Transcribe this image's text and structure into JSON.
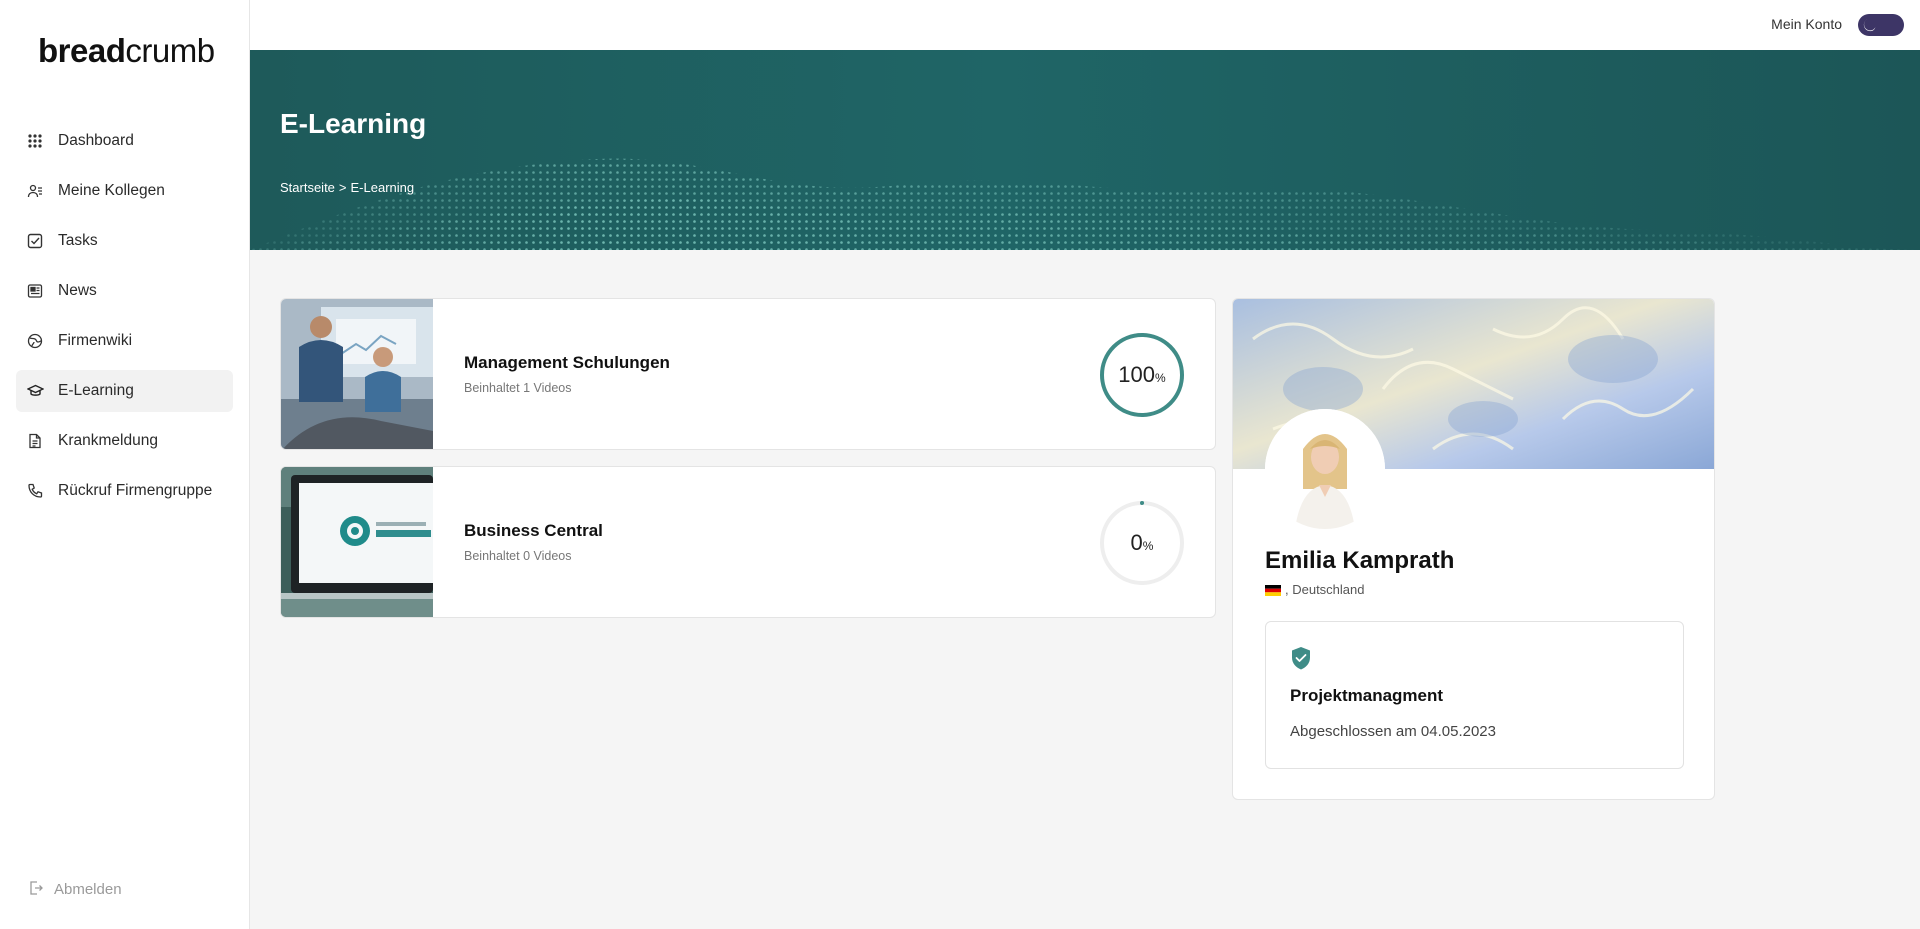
{
  "brand": {
    "bold": "bread",
    "light": "crumb"
  },
  "sidebar": {
    "items": [
      {
        "label": "Dashboard",
        "icon": "grid-icon"
      },
      {
        "label": "Meine Kollegen",
        "icon": "users-icon"
      },
      {
        "label": "Tasks",
        "icon": "checkbox-icon"
      },
      {
        "label": "News",
        "icon": "newspaper-icon"
      },
      {
        "label": "Firmenwiki",
        "icon": "globe-icon"
      },
      {
        "label": "E-Learning",
        "icon": "graduation-cap-icon",
        "active": true
      },
      {
        "label": "Krankmeldung",
        "icon": "document-icon"
      },
      {
        "label": "Rückruf Firmengruppe",
        "icon": "phone-icon"
      }
    ],
    "logout_label": "Abmelden"
  },
  "topbar": {
    "account_label": "Mein Konto"
  },
  "hero": {
    "title": "E-Learning",
    "breadcrumb": {
      "home": "Startseite",
      "separator": ">",
      "current": "E-Learning"
    }
  },
  "courses": [
    {
      "title": "Management Schulungen",
      "subtitle": "Beinhaltet 1 Videos",
      "progress": 100,
      "progress_label": "100",
      "pct": "%"
    },
    {
      "title": "Business Central",
      "subtitle": "Beinhaltet 0 Videos",
      "progress": 0,
      "progress_label": "0",
      "pct": "%"
    }
  ],
  "profile": {
    "name": "Emilia Kamprath",
    "country": ", Deutschland",
    "certificate": {
      "title": "Projektmanagment",
      "completed": "Abgeschlossen am 04.05.2023"
    }
  },
  "colors": {
    "accent": "#3f8c87",
    "hero": "#1f6566",
    "toggle": "#3d3566"
  }
}
